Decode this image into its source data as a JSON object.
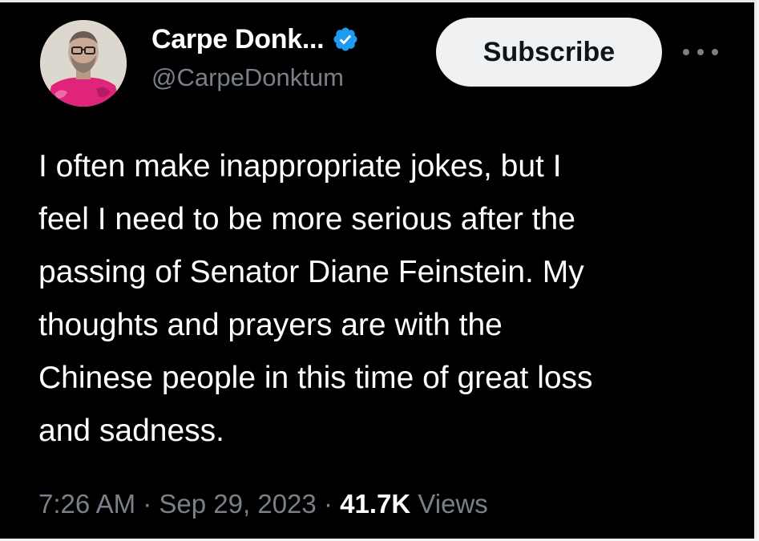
{
  "author": {
    "display_name": "Carpe Donk...",
    "handle": "@CarpeDonktum",
    "verified": true
  },
  "header": {
    "subscribe_label": "Subscribe",
    "more_icon": "more-horizontal-icon"
  },
  "tweet": {
    "text_lines": [
      "I often make inappropriate jokes, but I",
      "feel I need to be more serious after the",
      "passing of Senator Diane Feinstein. My",
      "thoughts and prayers are with the",
      "Chinese people in this time of great loss",
      "and sadness."
    ],
    "time": "7:26 AM",
    "date": "Sep 29, 2023",
    "views_count": "41.7K",
    "views_label": "Views"
  },
  "colors": {
    "background": "#000000",
    "text_primary": "#ffffff",
    "text_secondary": "#7a8089",
    "verified_badge": "#1d9bf0",
    "subscribe_bg": "#eff1f3"
  }
}
